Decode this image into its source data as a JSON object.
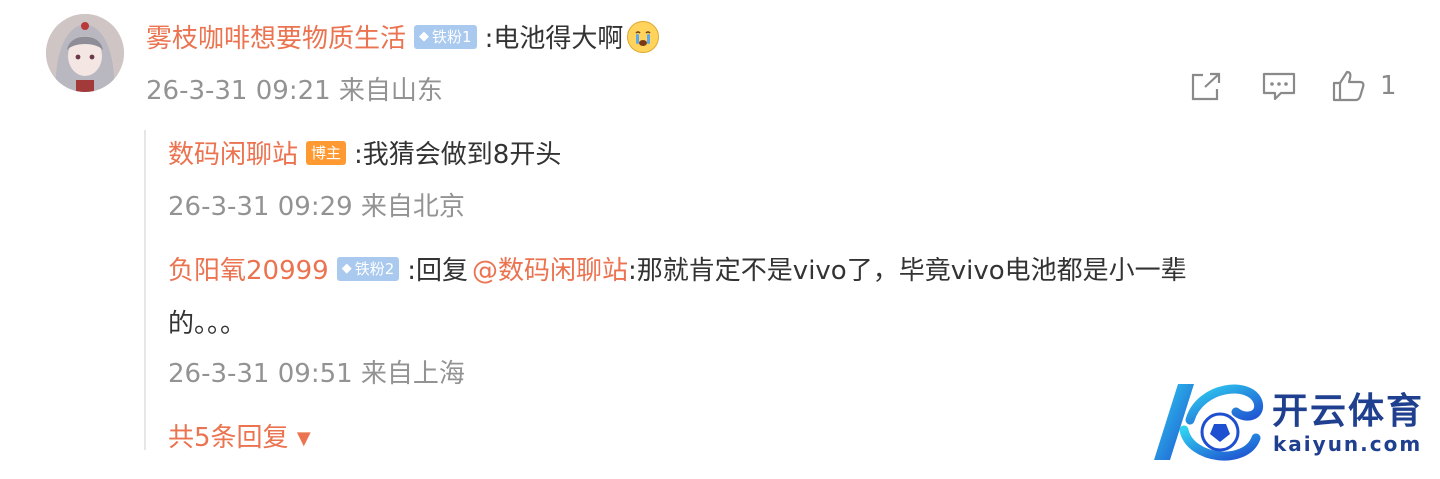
{
  "comment": {
    "username": "雾枝咖啡想要物质生活",
    "badge": "铁粉1",
    "text": ":电池得大啊",
    "meta": "26-3-31 09:21 来自山东",
    "like_count": "1"
  },
  "replies": [
    {
      "username": "数码闲聊站",
      "badge": "博主",
      "text": ":我猜会做到8开头",
      "meta": "26-3-31 09:29 来自北京"
    },
    {
      "username": "负阳氧20999",
      "badge": "铁粉2",
      "prefix": ":回复",
      "mention": "@数码闲聊站",
      "text_line1": ":那就肯定不是vivo了，毕竟vivo电池都是小一辈",
      "text_line2": "的。。。",
      "meta": "26-3-31 09:51 来自上海"
    }
  ],
  "more_replies": "共5条回复",
  "watermark": {
    "cn": "开云体育",
    "en": "kaiyun.com"
  },
  "colors": {
    "username": "#eb7350",
    "meta": "#939393",
    "fan_badge": "#a9c9ef",
    "host_badge": "#ff9a33"
  }
}
